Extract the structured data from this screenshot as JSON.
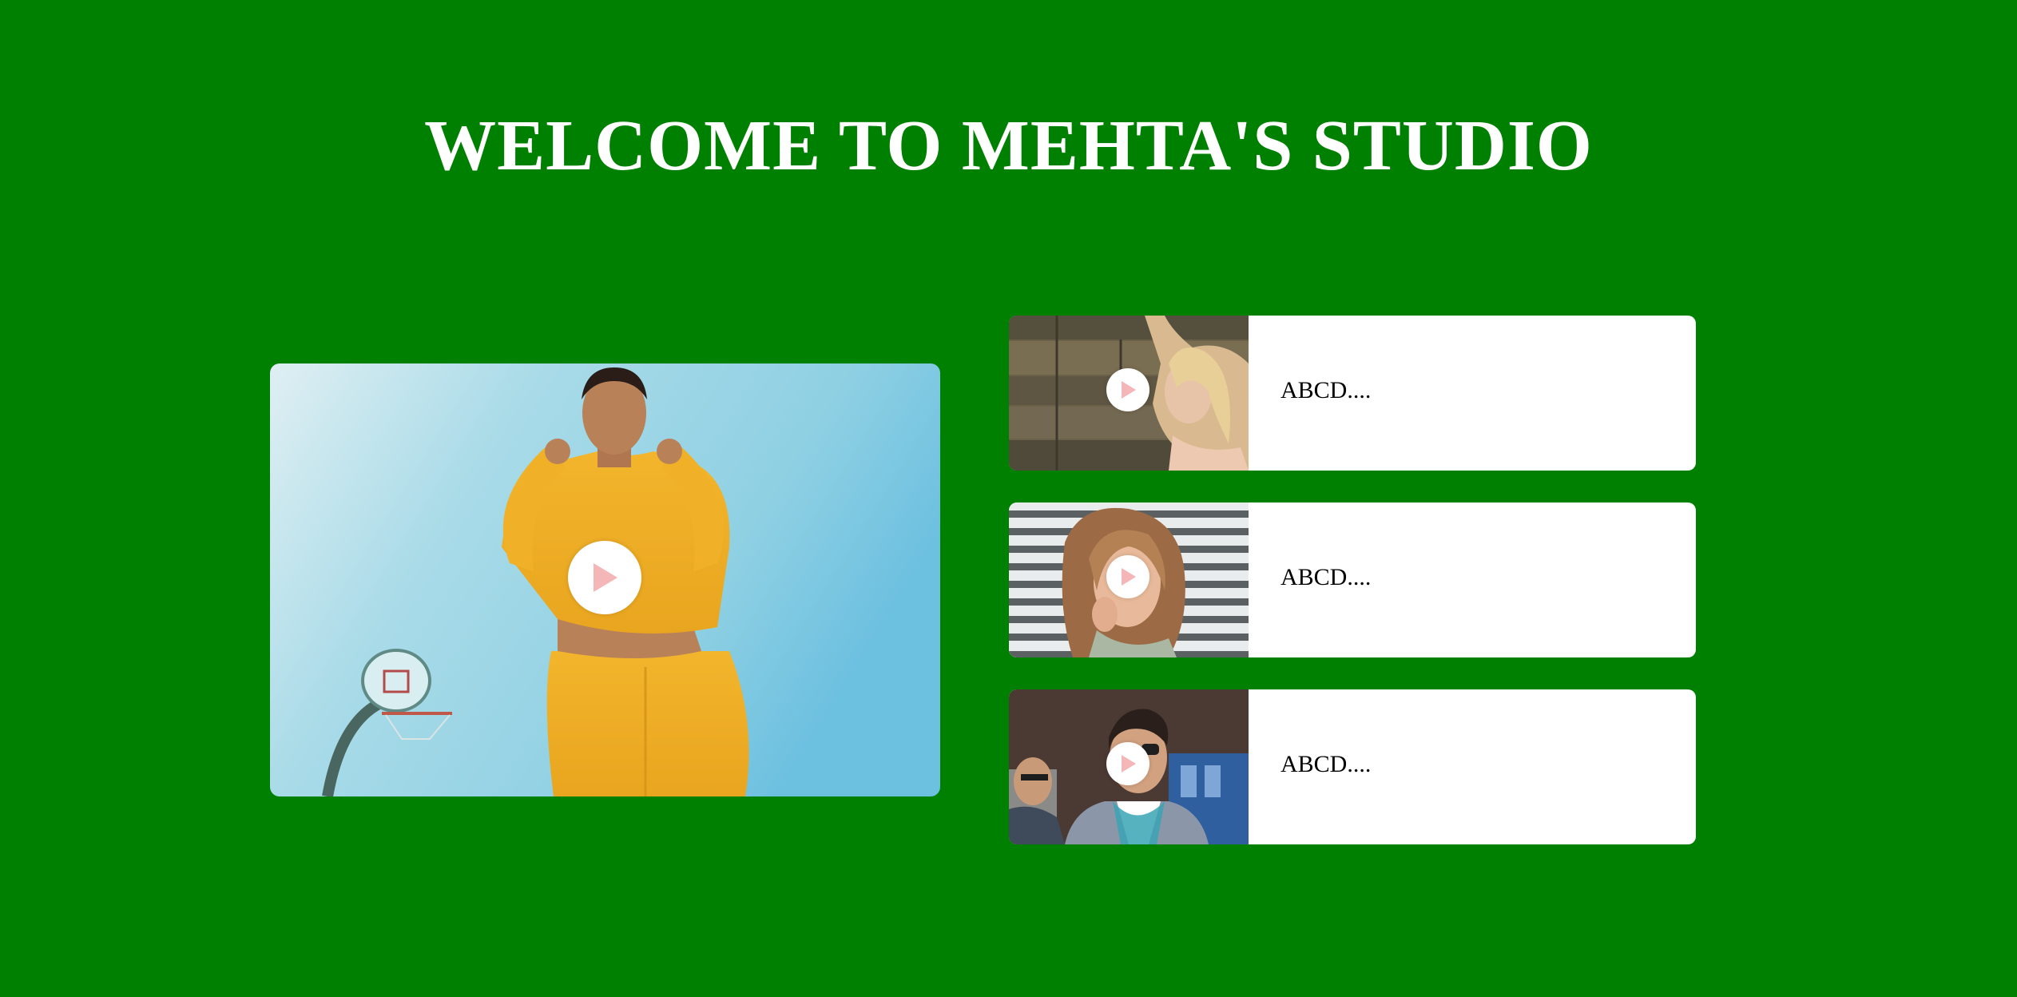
{
  "page": {
    "title": "WELCOME TO MEHTA'S STUDIO",
    "background_color": "#008000"
  },
  "featured_video": {
    "play_icon": "play-icon",
    "play_icon_color": "#f4b6b6"
  },
  "playlist": {
    "items": [
      {
        "label": "ABCD....",
        "thumbnail": "woman-blonde-wood-wall",
        "play_icon": "play-icon"
      },
      {
        "label": "ABCD....",
        "thumbnail": "woman-striped-background",
        "play_icon": "play-icon"
      },
      {
        "label": "ABCD....",
        "thumbnail": "man-sunglasses-street",
        "play_icon": "play-icon"
      }
    ]
  }
}
